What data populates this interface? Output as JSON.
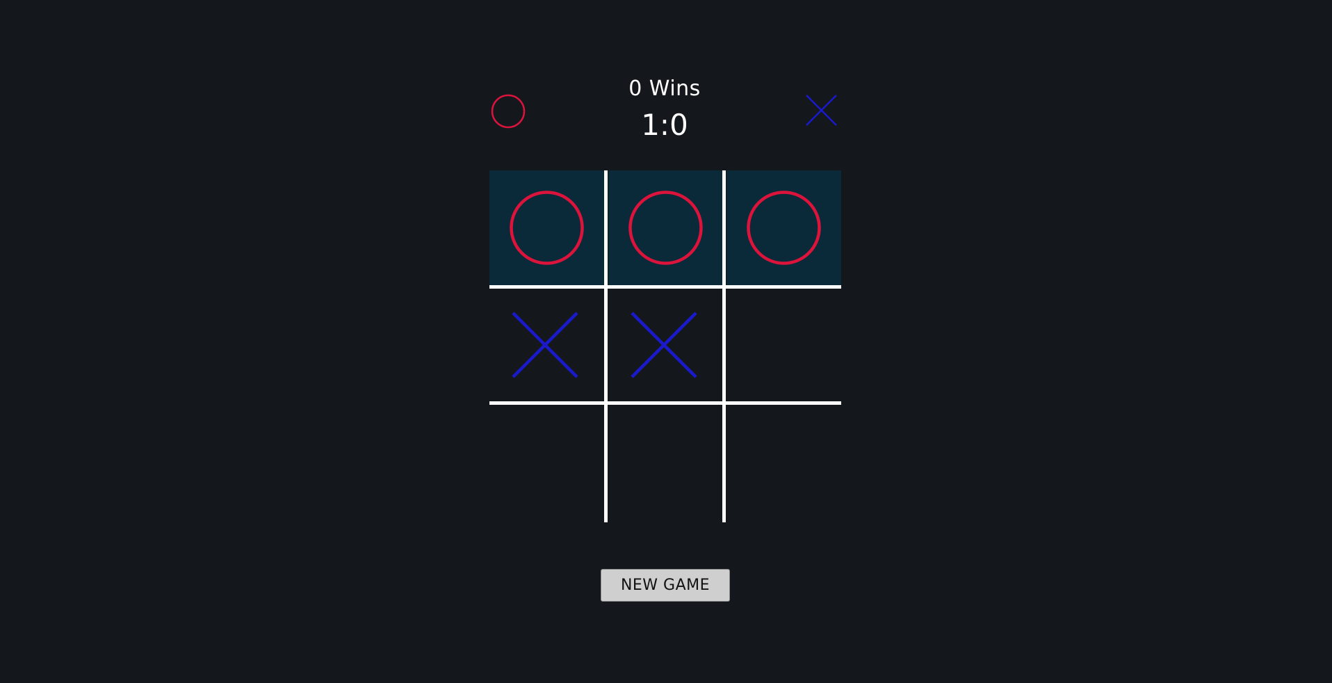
{
  "colors": {
    "background": "#14181c",
    "o_color": "#dc143c",
    "x_color": "#1a1acc",
    "win_highlight": "#0a2a3a",
    "grid": "#ffffff",
    "button_bg": "#cfcfcf"
  },
  "header": {
    "player_o_icon": "circle-icon",
    "player_x_icon": "cross-icon",
    "status": "0 Wins",
    "score": "1:0"
  },
  "board": {
    "cells": [
      "O",
      "O",
      "O",
      "X",
      "X",
      "",
      "",
      "",
      ""
    ],
    "winning_cells": [
      0,
      1,
      2
    ]
  },
  "controls": {
    "new_game_label": "NEW GAME"
  }
}
